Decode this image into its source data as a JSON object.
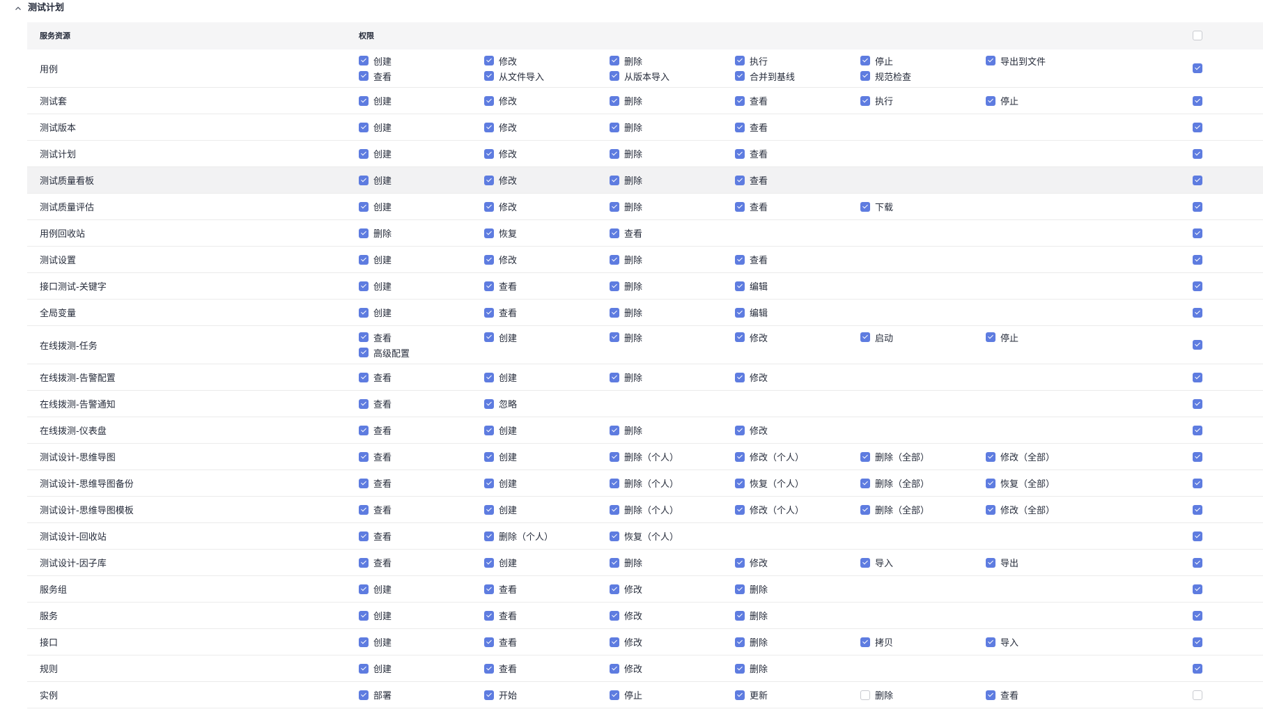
{
  "section": {
    "title": "测试计划"
  },
  "table": {
    "header": {
      "resource": "服务资源",
      "permission": "权限",
      "select_all": false
    },
    "rows": [
      {
        "resource": "用例",
        "all": true,
        "hover": false,
        "permissions": [
          {
            "label": "创建",
            "checked": true
          },
          {
            "label": "修改",
            "checked": true
          },
          {
            "label": "删除",
            "checked": true
          },
          {
            "label": "执行",
            "checked": true
          },
          {
            "label": "停止",
            "checked": true
          },
          {
            "label": "导出到文件",
            "checked": true
          },
          {
            "label": "查看",
            "checked": true
          },
          {
            "label": "从文件导入",
            "checked": true
          },
          {
            "label": "从版本导入",
            "checked": true
          },
          {
            "label": "合并到基线",
            "checked": true
          },
          {
            "label": "规范检查",
            "checked": true
          }
        ]
      },
      {
        "resource": "测试套",
        "all": true,
        "hover": false,
        "permissions": [
          {
            "label": "创建",
            "checked": true
          },
          {
            "label": "修改",
            "checked": true
          },
          {
            "label": "删除",
            "checked": true
          },
          {
            "label": "查看",
            "checked": true
          },
          {
            "label": "执行",
            "checked": true
          },
          {
            "label": "停止",
            "checked": true
          }
        ]
      },
      {
        "resource": "测试版本",
        "all": true,
        "hover": false,
        "permissions": [
          {
            "label": "创建",
            "checked": true
          },
          {
            "label": "修改",
            "checked": true
          },
          {
            "label": "删除",
            "checked": true
          },
          {
            "label": "查看",
            "checked": true
          }
        ]
      },
      {
        "resource": "测试计划",
        "all": true,
        "hover": false,
        "permissions": [
          {
            "label": "创建",
            "checked": true
          },
          {
            "label": "修改",
            "checked": true
          },
          {
            "label": "删除",
            "checked": true
          },
          {
            "label": "查看",
            "checked": true
          }
        ]
      },
      {
        "resource": "测试质量看板",
        "all": true,
        "hover": true,
        "permissions": [
          {
            "label": "创建",
            "checked": true
          },
          {
            "label": "修改",
            "checked": true
          },
          {
            "label": "删除",
            "checked": true
          },
          {
            "label": "查看",
            "checked": true
          }
        ]
      },
      {
        "resource": "测试质量评估",
        "all": true,
        "hover": false,
        "permissions": [
          {
            "label": "创建",
            "checked": true
          },
          {
            "label": "修改",
            "checked": true
          },
          {
            "label": "删除",
            "checked": true
          },
          {
            "label": "查看",
            "checked": true
          },
          {
            "label": "下载",
            "checked": true
          }
        ]
      },
      {
        "resource": "用例回收站",
        "all": true,
        "hover": false,
        "permissions": [
          {
            "label": "删除",
            "checked": true
          },
          {
            "label": "恢复",
            "checked": true
          },
          {
            "label": "查看",
            "checked": true
          }
        ]
      },
      {
        "resource": "测试设置",
        "all": true,
        "hover": false,
        "permissions": [
          {
            "label": "创建",
            "checked": true
          },
          {
            "label": "修改",
            "checked": true
          },
          {
            "label": "删除",
            "checked": true
          },
          {
            "label": "查看",
            "checked": true
          }
        ]
      },
      {
        "resource": "接口测试-关键字",
        "all": true,
        "hover": false,
        "permissions": [
          {
            "label": "创建",
            "checked": true
          },
          {
            "label": "查看",
            "checked": true
          },
          {
            "label": "删除",
            "checked": true
          },
          {
            "label": "编辑",
            "checked": true
          }
        ]
      },
      {
        "resource": "全局变量",
        "all": true,
        "hover": false,
        "permissions": [
          {
            "label": "创建",
            "checked": true
          },
          {
            "label": "查看",
            "checked": true
          },
          {
            "label": "删除",
            "checked": true
          },
          {
            "label": "编辑",
            "checked": true
          }
        ]
      },
      {
        "resource": "在线拨测-任务",
        "all": true,
        "hover": false,
        "permissions": [
          {
            "label": "查看",
            "checked": true
          },
          {
            "label": "创建",
            "checked": true
          },
          {
            "label": "删除",
            "checked": true
          },
          {
            "label": "修改",
            "checked": true
          },
          {
            "label": "启动",
            "checked": true
          },
          {
            "label": "停止",
            "checked": true
          },
          {
            "label": "高级配置",
            "checked": true
          }
        ]
      },
      {
        "resource": "在线拨测-告警配置",
        "all": true,
        "hover": false,
        "permissions": [
          {
            "label": "查看",
            "checked": true
          },
          {
            "label": "创建",
            "checked": true
          },
          {
            "label": "删除",
            "checked": true
          },
          {
            "label": "修改",
            "checked": true
          }
        ]
      },
      {
        "resource": "在线拨测-告警通知",
        "all": true,
        "hover": false,
        "permissions": [
          {
            "label": "查看",
            "checked": true
          },
          {
            "label": "忽略",
            "checked": true
          }
        ]
      },
      {
        "resource": "在线拨测-仪表盘",
        "all": true,
        "hover": false,
        "permissions": [
          {
            "label": "查看",
            "checked": true
          },
          {
            "label": "创建",
            "checked": true
          },
          {
            "label": "删除",
            "checked": true
          },
          {
            "label": "修改",
            "checked": true
          }
        ]
      },
      {
        "resource": "测试设计-思维导图",
        "all": true,
        "hover": false,
        "permissions": [
          {
            "label": "查看",
            "checked": true
          },
          {
            "label": "创建",
            "checked": true
          },
          {
            "label": "删除（个人）",
            "checked": true
          },
          {
            "label": "修改（个人）",
            "checked": true
          },
          {
            "label": "删除（全部）",
            "checked": true
          },
          {
            "label": "修改（全部）",
            "checked": true
          }
        ]
      },
      {
        "resource": "测试设计-思维导图备份",
        "all": true,
        "hover": false,
        "permissions": [
          {
            "label": "查看",
            "checked": true
          },
          {
            "label": "创建",
            "checked": true
          },
          {
            "label": "删除（个人）",
            "checked": true
          },
          {
            "label": "恢复（个人）",
            "checked": true
          },
          {
            "label": "删除（全部）",
            "checked": true
          },
          {
            "label": "恢复（全部）",
            "checked": true
          }
        ]
      },
      {
        "resource": "测试设计-思维导图模板",
        "all": true,
        "hover": false,
        "permissions": [
          {
            "label": "查看",
            "checked": true
          },
          {
            "label": "创建",
            "checked": true
          },
          {
            "label": "删除（个人）",
            "checked": true
          },
          {
            "label": "修改（个人）",
            "checked": true
          },
          {
            "label": "删除（全部）",
            "checked": true
          },
          {
            "label": "修改（全部）",
            "checked": true
          }
        ]
      },
      {
        "resource": "测试设计-回收站",
        "all": true,
        "hover": false,
        "permissions": [
          {
            "label": "查看",
            "checked": true
          },
          {
            "label": "删除（个人）",
            "checked": true
          },
          {
            "label": "恢复（个人）",
            "checked": true
          }
        ]
      },
      {
        "resource": "测试设计-因子库",
        "all": true,
        "hover": false,
        "permissions": [
          {
            "label": "查看",
            "checked": true
          },
          {
            "label": "创建",
            "checked": true
          },
          {
            "label": "删除",
            "checked": true
          },
          {
            "label": "修改",
            "checked": true
          },
          {
            "label": "导入",
            "checked": true
          },
          {
            "label": "导出",
            "checked": true
          }
        ]
      },
      {
        "resource": "服务组",
        "all": true,
        "hover": false,
        "permissions": [
          {
            "label": "创建",
            "checked": true
          },
          {
            "label": "查看",
            "checked": true
          },
          {
            "label": "修改",
            "checked": true
          },
          {
            "label": "删除",
            "checked": true
          }
        ]
      },
      {
        "resource": "服务",
        "all": true,
        "hover": false,
        "permissions": [
          {
            "label": "创建",
            "checked": true
          },
          {
            "label": "查看",
            "checked": true
          },
          {
            "label": "修改",
            "checked": true
          },
          {
            "label": "删除",
            "checked": true
          }
        ]
      },
      {
        "resource": "接口",
        "all": true,
        "hover": false,
        "permissions": [
          {
            "label": "创建",
            "checked": true
          },
          {
            "label": "查看",
            "checked": true
          },
          {
            "label": "修改",
            "checked": true
          },
          {
            "label": "删除",
            "checked": true
          },
          {
            "label": "拷贝",
            "checked": true
          },
          {
            "label": "导入",
            "checked": true
          }
        ]
      },
      {
        "resource": "规则",
        "all": true,
        "hover": false,
        "permissions": [
          {
            "label": "创建",
            "checked": true
          },
          {
            "label": "查看",
            "checked": true
          },
          {
            "label": "修改",
            "checked": true
          },
          {
            "label": "删除",
            "checked": true
          }
        ]
      },
      {
        "resource": "实例",
        "all": false,
        "hover": false,
        "permissions": [
          {
            "label": "部署",
            "checked": true
          },
          {
            "label": "开始",
            "checked": true
          },
          {
            "label": "停止",
            "checked": true
          },
          {
            "label": "更新",
            "checked": true
          },
          {
            "label": "删除",
            "checked": false
          },
          {
            "label": "查看",
            "checked": true
          }
        ]
      }
    ]
  }
}
